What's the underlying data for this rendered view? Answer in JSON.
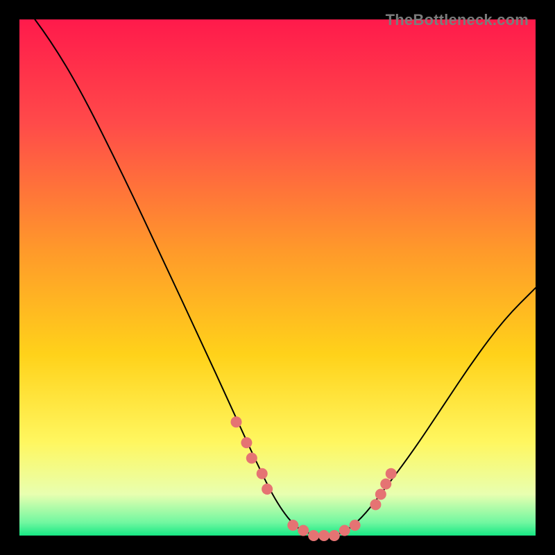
{
  "watermark": "TheBottleneck.com",
  "chart_data": {
    "type": "line",
    "title": "",
    "xlabel": "",
    "ylabel": "",
    "x_range": [
      0,
      100
    ],
    "y_range": [
      0,
      100
    ],
    "grid": false,
    "legend": false,
    "background_gradient": {
      "stops": [
        {
          "offset": 0.0,
          "color": "#ff1a4b"
        },
        {
          "offset": 0.2,
          "color": "#ff4a4a"
        },
        {
          "offset": 0.45,
          "color": "#ff9a2a"
        },
        {
          "offset": 0.65,
          "color": "#ffd21a"
        },
        {
          "offset": 0.82,
          "color": "#fff760"
        },
        {
          "offset": 0.92,
          "color": "#e8ffb0"
        },
        {
          "offset": 0.975,
          "color": "#70f7a0"
        },
        {
          "offset": 1.0,
          "color": "#17e884"
        }
      ]
    },
    "series": [
      {
        "name": "bottleneck-curve",
        "comment": "V-shaped curve; y ≈ 100 at left, dips to ~0 around x=55-62, rises to ~48 at right edge",
        "points": [
          {
            "x": 3,
            "y": 100
          },
          {
            "x": 6,
            "y": 96
          },
          {
            "x": 12,
            "y": 86
          },
          {
            "x": 20,
            "y": 70
          },
          {
            "x": 28,
            "y": 53
          },
          {
            "x": 35,
            "y": 38
          },
          {
            "x": 41,
            "y": 25
          },
          {
            "x": 46,
            "y": 14
          },
          {
            "x": 50,
            "y": 6
          },
          {
            "x": 54,
            "y": 1
          },
          {
            "x": 58,
            "y": 0
          },
          {
            "x": 62,
            "y": 0
          },
          {
            "x": 66,
            "y": 3
          },
          {
            "x": 70,
            "y": 8
          },
          {
            "x": 76,
            "y": 16
          },
          {
            "x": 82,
            "y": 25
          },
          {
            "x": 88,
            "y": 34
          },
          {
            "x": 94,
            "y": 42
          },
          {
            "x": 100,
            "y": 48
          }
        ]
      }
    ],
    "highlight_dots": {
      "comment": "Salmon-pink dot clusters near the valley on both arms of the V",
      "color": "#e57373",
      "radius": 8,
      "points": [
        {
          "x": 42,
          "y": 22
        },
        {
          "x": 44,
          "y": 18
        },
        {
          "x": 45,
          "y": 15
        },
        {
          "x": 47,
          "y": 12
        },
        {
          "x": 48,
          "y": 9
        },
        {
          "x": 53,
          "y": 2
        },
        {
          "x": 55,
          "y": 1
        },
        {
          "x": 57,
          "y": 0
        },
        {
          "x": 59,
          "y": 0
        },
        {
          "x": 61,
          "y": 0
        },
        {
          "x": 63,
          "y": 1
        },
        {
          "x": 65,
          "y": 2
        },
        {
          "x": 69,
          "y": 6
        },
        {
          "x": 70,
          "y": 8
        },
        {
          "x": 71,
          "y": 10
        },
        {
          "x": 72,
          "y": 12
        }
      ]
    }
  }
}
